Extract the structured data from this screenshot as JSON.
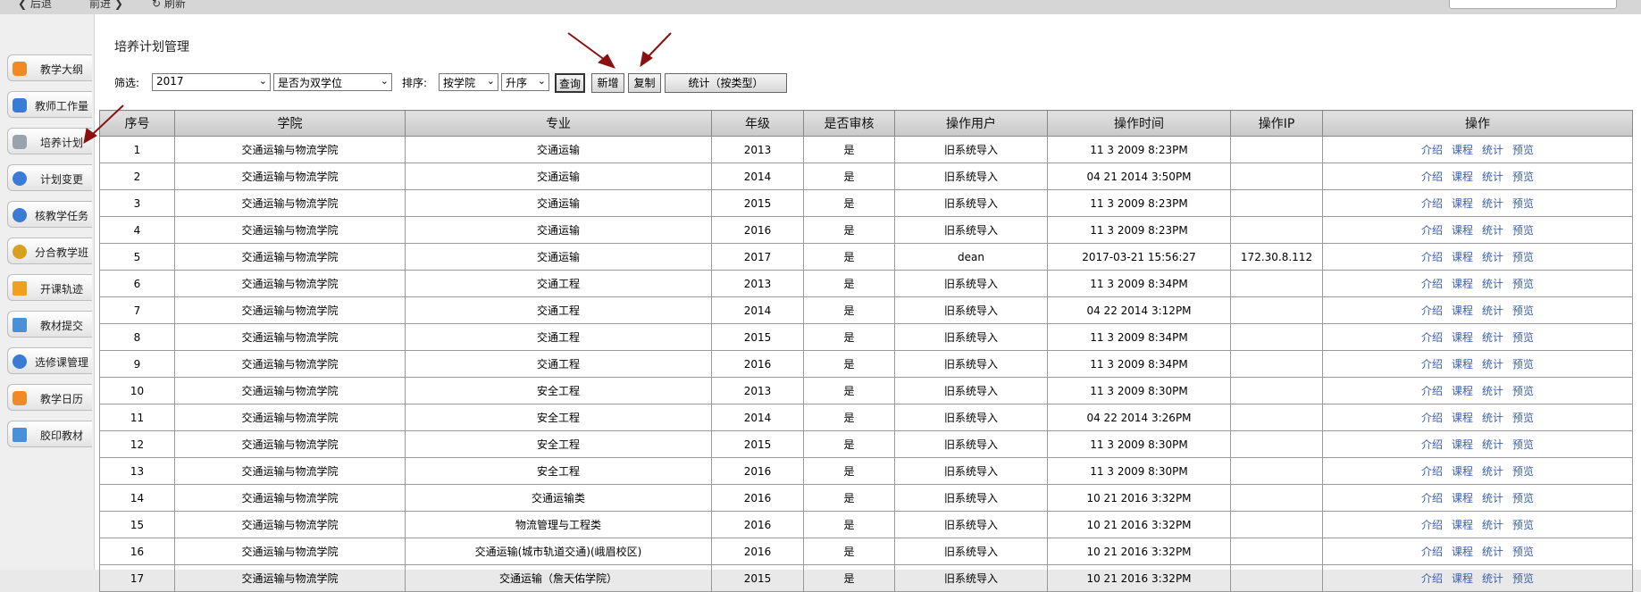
{
  "browser": {
    "back_label": "后退",
    "forward_label": "前进",
    "refresh_label": "刷新"
  },
  "sidebar": {
    "items": [
      {
        "label": "教学大纲",
        "icon": "home-icon",
        "color": "#f08a24"
      },
      {
        "label": "教师工作量",
        "icon": "cart-icon",
        "color": "#3a7bd5"
      },
      {
        "label": "培养计划",
        "icon": "lock-icon",
        "color": "#9aa3ad"
      },
      {
        "label": "计划变更",
        "icon": "user-icon",
        "color": "#3a7bd5"
      },
      {
        "label": "核教学任务",
        "icon": "search-icon",
        "color": "#3a7bd5"
      },
      {
        "label": "分合教学班",
        "icon": "group-icon",
        "color": "#d9a020"
      },
      {
        "label": "开课轨迹",
        "icon": "folder-icon",
        "color": "#f0a020"
      },
      {
        "label": "教材提交",
        "icon": "calendar-icon",
        "color": "#4a90d9"
      },
      {
        "label": "选修课管理",
        "icon": "user-icon",
        "color": "#3a7bd5"
      },
      {
        "label": "教学日历",
        "icon": "home-icon",
        "color": "#f08a24"
      },
      {
        "label": "胶印教材",
        "icon": "calendar-icon",
        "color": "#4a90d9"
      }
    ]
  },
  "panel": {
    "title": "培养计划管理"
  },
  "filter": {
    "filter_label": "筛选:",
    "year_value": "2017",
    "double_degree_value": "是否为双学位",
    "sort_label": "排序:",
    "sort_by_value": "按学院",
    "order_value": "升序",
    "query_label": "查询",
    "add_label": "新增",
    "copy_label": "复制",
    "stats_label": "统计（按类型）"
  },
  "table": {
    "headers": [
      "序号",
      "学院",
      "专业",
      "年级",
      "是否审核",
      "操作用户",
      "操作时间",
      "操作IP",
      "操作"
    ],
    "actions": [
      "介绍",
      "课程",
      "统计",
      "预览"
    ],
    "rows": [
      [
        "1",
        "交通运输与物流学院",
        "交通运输",
        "2013",
        "是",
        "旧系统导入",
        "11 3 2009 8:23PM",
        ""
      ],
      [
        "2",
        "交通运输与物流学院",
        "交通运输",
        "2014",
        "是",
        "旧系统导入",
        "04 21 2014 3:50PM",
        ""
      ],
      [
        "3",
        "交通运输与物流学院",
        "交通运输",
        "2015",
        "是",
        "旧系统导入",
        "11 3 2009 8:23PM",
        ""
      ],
      [
        "4",
        "交通运输与物流学院",
        "交通运输",
        "2016",
        "是",
        "旧系统导入",
        "11 3 2009 8:23PM",
        ""
      ],
      [
        "5",
        "交通运输与物流学院",
        "交通运输",
        "2017",
        "是",
        "dean",
        "2017-03-21 15:56:27",
        "172.30.8.112"
      ],
      [
        "6",
        "交通运输与物流学院",
        "交通工程",
        "2013",
        "是",
        "旧系统导入",
        "11 3 2009 8:34PM",
        ""
      ],
      [
        "7",
        "交通运输与物流学院",
        "交通工程",
        "2014",
        "是",
        "旧系统导入",
        "04 22 2014 3:12PM",
        ""
      ],
      [
        "8",
        "交通运输与物流学院",
        "交通工程",
        "2015",
        "是",
        "旧系统导入",
        "11 3 2009 8:34PM",
        ""
      ],
      [
        "9",
        "交通运输与物流学院",
        "交通工程",
        "2016",
        "是",
        "旧系统导入",
        "11 3 2009 8:34PM",
        ""
      ],
      [
        "10",
        "交通运输与物流学院",
        "安全工程",
        "2013",
        "是",
        "旧系统导入",
        "11 3 2009 8:30PM",
        ""
      ],
      [
        "11",
        "交通运输与物流学院",
        "安全工程",
        "2014",
        "是",
        "旧系统导入",
        "04 22 2014 3:26PM",
        ""
      ],
      [
        "12",
        "交通运输与物流学院",
        "安全工程",
        "2015",
        "是",
        "旧系统导入",
        "11 3 2009 8:30PM",
        ""
      ],
      [
        "13",
        "交通运输与物流学院",
        "安全工程",
        "2016",
        "是",
        "旧系统导入",
        "11 3 2009 8:30PM",
        ""
      ],
      [
        "14",
        "交通运输与物流学院",
        "交通运输类",
        "2016",
        "是",
        "旧系统导入",
        "10 21 2016 3:32PM",
        ""
      ],
      [
        "15",
        "交通运输与物流学院",
        "物流管理与工程类",
        "2016",
        "是",
        "旧系统导入",
        "10 21 2016 3:32PM",
        ""
      ],
      [
        "16",
        "交通运输与物流学院",
        "交通运输(城市轨道交通)(峨眉校区)",
        "2016",
        "是",
        "旧系统导入",
        "10 21 2016 3:32PM",
        ""
      ],
      [
        "17",
        "交通运输与物流学院",
        "交通运输（詹天佑学院）",
        "2015",
        "是",
        "旧系统导入",
        "10 21 2016 3:32PM",
        ""
      ]
    ]
  },
  "colors": {
    "arrow": "#8b1010",
    "link": "#3a5fa8"
  }
}
